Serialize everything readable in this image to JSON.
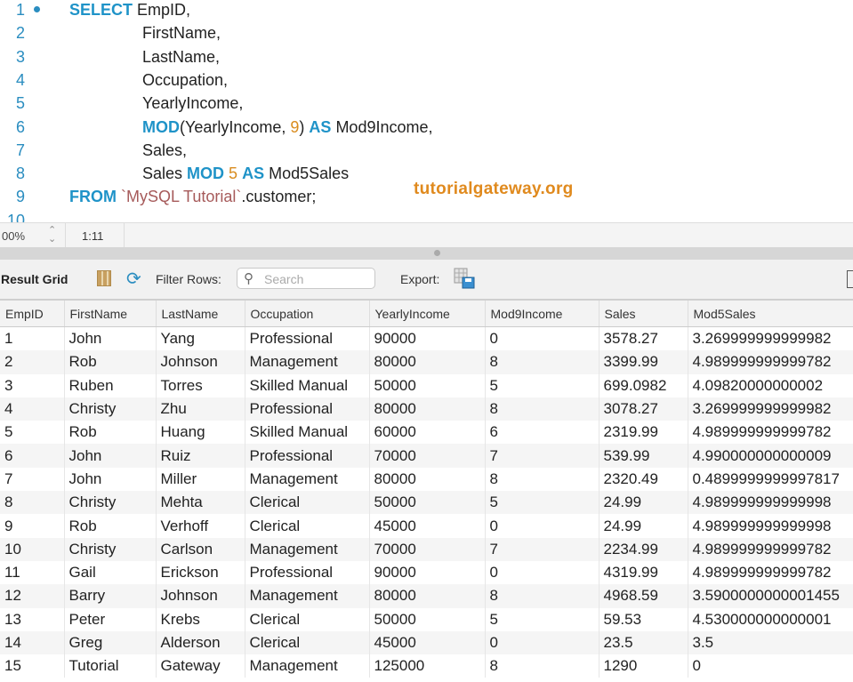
{
  "editor": {
    "lines": [
      {
        "n": "1",
        "dot": true,
        "indent": false,
        "tokens": [
          [
            "kw",
            "SELECT"
          ],
          [
            "txt",
            " EmpID,"
          ]
        ]
      },
      {
        "n": "2",
        "indent": true,
        "tokens": [
          [
            "txt",
            "FirstName,"
          ]
        ]
      },
      {
        "n": "3",
        "indent": true,
        "tokens": [
          [
            "txt",
            "LastName,"
          ]
        ]
      },
      {
        "n": "4",
        "indent": true,
        "tokens": [
          [
            "txt",
            "Occupation,"
          ]
        ]
      },
      {
        "n": "5",
        "indent": true,
        "tokens": [
          [
            "txt",
            "YearlyIncome,"
          ]
        ]
      },
      {
        "n": "6",
        "indent": true,
        "tokens": [
          [
            "kw",
            "MOD"
          ],
          [
            "txt",
            "(YearlyIncome, "
          ],
          [
            "num",
            "9"
          ],
          [
            "txt",
            ") "
          ],
          [
            "kw",
            "AS"
          ],
          [
            "txt",
            " Mod9Income,"
          ]
        ]
      },
      {
        "n": "7",
        "indent": true,
        "tokens": [
          [
            "txt",
            "Sales,"
          ]
        ]
      },
      {
        "n": "8",
        "indent": true,
        "tokens": [
          [
            "txt",
            "Sales "
          ],
          [
            "kw",
            "MOD"
          ],
          [
            "txt",
            " "
          ],
          [
            "num",
            "5"
          ],
          [
            "txt",
            " "
          ],
          [
            "kw",
            "AS"
          ],
          [
            "txt",
            " Mod5Sales"
          ]
        ]
      },
      {
        "n": "9",
        "indent": false,
        "tokens": [
          [
            "kw",
            "FROM"
          ],
          [
            "txt",
            " "
          ],
          [
            "str",
            "`MySQL Tutorial`"
          ],
          [
            "txt",
            ".customer;"
          ]
        ]
      },
      {
        "n": "10",
        "indent": false,
        "tokens": []
      }
    ],
    "watermark": "tutorialgateway.org"
  },
  "colors": {
    "keyword": "#1f93c8",
    "number": "#d98c1f",
    "string": "#a65a5a",
    "watermark": "#e08a1e"
  },
  "status": {
    "zoom": "00%",
    "cursor": "1:11"
  },
  "toolbar": {
    "result_grid": "Result Grid",
    "grid_icon": "grid-layout-icon",
    "refresh_icon": "refresh-icon",
    "filter_label": "Filter Rows:",
    "search_placeholder": "Search",
    "export_label": "Export:",
    "export_icon": "export-save-icon"
  },
  "table": {
    "columns": [
      "EmpID",
      "FirstName",
      "LastName",
      "Occupation",
      "YearlyIncome",
      "Mod9Income",
      "Sales",
      "Mod5Sales"
    ],
    "rows": [
      [
        "1",
        "John",
        "Yang",
        "Professional",
        "90000",
        "0",
        "3578.27",
        "3.269999999999982"
      ],
      [
        "2",
        "Rob",
        "Johnson",
        "Management",
        "80000",
        "8",
        "3399.99",
        "4.989999999999782"
      ],
      [
        "3",
        "Ruben",
        "Torres",
        "Skilled Manual",
        "50000",
        "5",
        "699.0982",
        "4.09820000000002"
      ],
      [
        "4",
        "Christy",
        "Zhu",
        "Professional",
        "80000",
        "8",
        "3078.27",
        "3.269999999999982"
      ],
      [
        "5",
        "Rob",
        "Huang",
        "Skilled Manual",
        "60000",
        "6",
        "2319.99",
        "4.989999999999782"
      ],
      [
        "6",
        "John",
        "Ruiz",
        "Professional",
        "70000",
        "7",
        "539.99",
        "4.990000000000009"
      ],
      [
        "7",
        "John",
        "Miller",
        "Management",
        "80000",
        "8",
        "2320.49",
        "0.4899999999997817"
      ],
      [
        "8",
        "Christy",
        "Mehta",
        "Clerical",
        "50000",
        "5",
        "24.99",
        "4.989999999999998"
      ],
      [
        "9",
        "Rob",
        "Verhoff",
        "Clerical",
        "45000",
        "0",
        "24.99",
        "4.989999999999998"
      ],
      [
        "10",
        "Christy",
        "Carlson",
        "Management",
        "70000",
        "7",
        "2234.99",
        "4.989999999999782"
      ],
      [
        "11",
        "Gail",
        "Erickson",
        "Professional",
        "90000",
        "0",
        "4319.99",
        "4.989999999999782"
      ],
      [
        "12",
        "Barry",
        "Johnson",
        "Management",
        "80000",
        "8",
        "4968.59",
        "3.5900000000001455"
      ],
      [
        "13",
        "Peter",
        "Krebs",
        "Clerical",
        "50000",
        "5",
        "59.53",
        "4.530000000000001"
      ],
      [
        "14",
        "Greg",
        "Alderson",
        "Clerical",
        "45000",
        "0",
        "23.5",
        "3.5"
      ],
      [
        "15",
        "Tutorial",
        "Gateway",
        "Management",
        "125000",
        "8",
        "1290",
        "0"
      ]
    ]
  }
}
